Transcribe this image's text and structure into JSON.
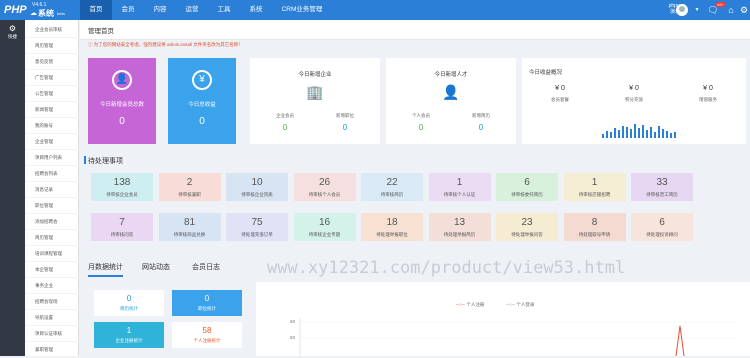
{
  "logo": {
    "php": "PHP",
    "version": "V4.6.1",
    "cloud": "☁",
    "system": "系统",
    "beta": "beta"
  },
  "nav": [
    "首页",
    "会员",
    "内容",
    "运营",
    "工具",
    "系统",
    "CRM业务管理"
  ],
  "user": {
    "name": "phpyun",
    "role": "演示组",
    "badge": "99+"
  },
  "sidebar_active": "快捷",
  "submenu": [
    "企业会员审核",
    "简历管理",
    "意见反馈",
    "广告管理",
    "公告管理",
    "新闻管理",
    "我的账号",
    "企业管理",
    "项目用户列表",
    "招聘会列表",
    "消息记录",
    "职位管理",
    "添加招聘会",
    "简历管理",
    "培训课程管理",
    "本企管理",
    "事务企业",
    "招聘会现场",
    "导航设置",
    "项目认证审核",
    "兼职管理"
  ],
  "breadcrumb": "管理首页",
  "notice": "为了您的网站安全考虑，强烈建议将 admin,install 文件夹名改为其它名称！",
  "big_cards": [
    {
      "label": "今日新增会员总数",
      "value": "0",
      "color": "#c565d6",
      "icon": "users-icon",
      "glyph": "👥"
    },
    {
      "label": "今日总收益",
      "value": "0",
      "color": "#3ba2ec",
      "icon": "money-bag-icon",
      "glyph": "¥"
    }
  ],
  "company_card": {
    "title": "今日新增企业",
    "sub1": "企业会员",
    "val1": "0",
    "sub2": "新增职位",
    "val2": "0"
  },
  "talent_card": {
    "title": "今日新增人才",
    "sub1": "个人会员",
    "val1": "0",
    "sub2": "新增简历",
    "val2": "0"
  },
  "income_card": {
    "title": "今日收益概况",
    "items": [
      {
        "value": "¥ 0",
        "label": "会员套餐"
      },
      {
        "value": "¥ 0",
        "label": "积分充值"
      },
      {
        "value": "¥ 0",
        "label": "增值服务"
      }
    ],
    "bars": [
      0.2,
      0.35,
      0.3,
      0.5,
      0.4,
      0.6,
      0.55,
      0.45,
      0.7,
      0.5,
      0.65,
      0.4,
      0.55,
      0.3,
      0.6,
      0.45,
      0.35,
      0.25,
      0.3
    ]
  },
  "todo_title": "待处理事项",
  "todo": [
    {
      "n": "138",
      "l": "待审核企业会员",
      "c": "#cfeef1"
    },
    {
      "n": "2",
      "l": "待审核兼职",
      "c": "#f8dcd7"
    },
    {
      "n": "10",
      "l": "待审核企业资质",
      "c": "#d7e4f3"
    },
    {
      "n": "26",
      "l": "待审核个人会员",
      "c": "#f5e0df"
    },
    {
      "n": "22",
      "l": "待审核简历",
      "c": "#d9eaf6"
    },
    {
      "n": "1",
      "l": "待审核个人认证",
      "c": "#ecdcf3"
    },
    {
      "n": "6",
      "l": "待审核委托简历",
      "c": "#d8f1dc"
    },
    {
      "n": "1",
      "l": "待审核店铺招聘",
      "c": "#f6edd5"
    },
    {
      "n": "33",
      "l": "待审核普工简历",
      "c": "#e7d7f2"
    },
    {
      "n": "7",
      "l": "待审核问答",
      "c": "#ead7f3"
    },
    {
      "n": "81",
      "l": "待审核商品兑换",
      "c": "#d6e4f3"
    },
    {
      "n": "75",
      "l": "待处理充值订单",
      "c": "#dfe3f5"
    },
    {
      "n": "16",
      "l": "待审核企业专题",
      "c": "#d4f1ea"
    },
    {
      "n": "18",
      "l": "待处理举报职位",
      "c": "#f6e1d2"
    },
    {
      "n": "13",
      "l": "待处理举报简历",
      "c": "#f3dfd8"
    },
    {
      "n": "23",
      "l": "待处理举报问答",
      "c": "#f6ebd3"
    },
    {
      "n": "8",
      "l": "待处理取号申请",
      "c": "#f5dad2"
    },
    {
      "n": "6",
      "l": "待处理投诉顾问",
      "c": "#f7e4da"
    }
  ],
  "tabs": [
    "月数据统计",
    "网站动态",
    "会员日志"
  ],
  "watermark": "www.xy12321.com/product/view53.html",
  "mini": [
    {
      "n": "0",
      "l": "简历统计",
      "c": "#ffffff",
      "tc": "#1a9cd4"
    },
    {
      "n": "0",
      "l": "职位统计",
      "c": "#3ba2ec",
      "tc": "#ffffff"
    },
    {
      "n": "1",
      "l": "企业注册统计",
      "c": "#2fb3d8",
      "tc": "#ffffff"
    },
    {
      "n": "58",
      "l": "个人注册统计",
      "c": "#ffffff",
      "tc": "#e05a2b"
    }
  ],
  "chart_legend": [
    "个人注册",
    "个人登录"
  ],
  "chart_yticks": [
    "60",
    "50"
  ]
}
